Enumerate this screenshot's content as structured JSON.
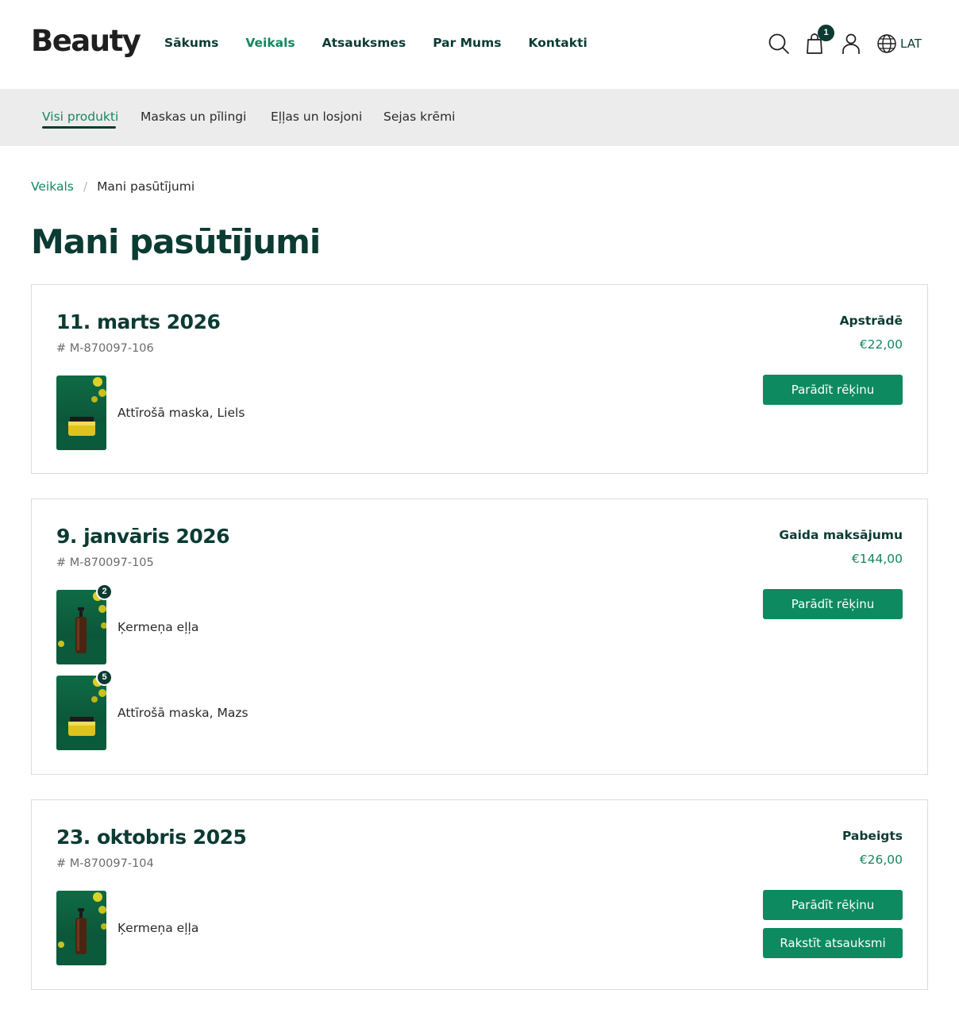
{
  "header": {
    "logo": "Beauty",
    "nav": [
      "Sākums",
      "Veikals",
      "Atsauksmes",
      "Par Mums",
      "Kontakti"
    ],
    "cart_count": "1",
    "language": "LAT"
  },
  "subnav": {
    "items": [
      "Visi produkti",
      "Maskas un pīlingi",
      "Eļļas un losjoni",
      "Sejas krēmi"
    ]
  },
  "breadcrumb": {
    "parent": "Veikals",
    "separator": "/",
    "current": "Mani pasūtījumi"
  },
  "page_title": "Mani pasūtījumi",
  "orders": [
    {
      "date": "11. marts 2026",
      "number": "# M-870097-106",
      "status": "Apstrādē",
      "total": "€22,00",
      "buttons": [
        "Parādīt rēķinu"
      ],
      "items": [
        {
          "name": "Attīrošā maska, Liels",
          "image": "jar-icon",
          "qty": ""
        }
      ]
    },
    {
      "date": "9. janvāris 2026",
      "number": "# M-870097-105",
      "status": "Gaida maksājumu",
      "total": "€144,00",
      "buttons": [
        "Parādīt rēķinu"
      ],
      "items": [
        {
          "name": "Ķermeņa eļļa",
          "image": "bottle-icon",
          "qty": "2"
        },
        {
          "name": "Attīrošā maska, Mazs",
          "image": "jar-icon",
          "qty": "5"
        }
      ]
    },
    {
      "date": "23. oktobris 2025",
      "number": "# M-870097-104",
      "status": "Pabeigts",
      "total": "€26,00",
      "buttons": [
        "Parādīt rēķinu",
        "Rakstīt atsauksmi"
      ],
      "items": [
        {
          "name": "Ķermeņa eļļa",
          "image": "bottle-icon",
          "qty": ""
        }
      ]
    }
  ],
  "colors": {
    "brand_dark": "#0b3b33",
    "accent_green": "#15865f",
    "button_green": "#0d8a5f",
    "subnav_bg": "#ececec"
  }
}
